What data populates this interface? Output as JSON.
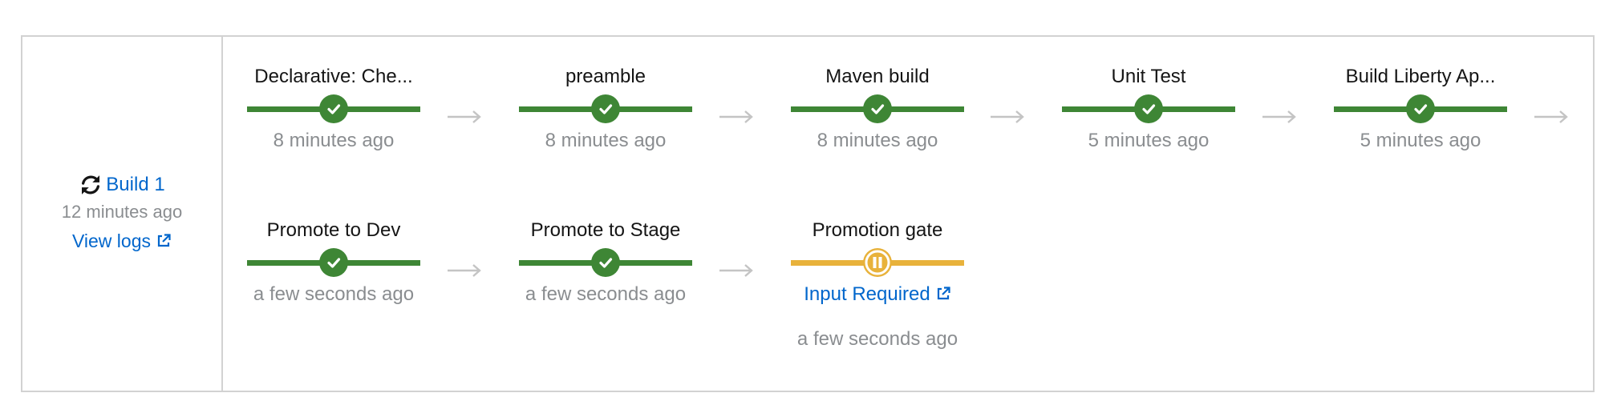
{
  "build": {
    "name": "Build 1",
    "time": "12 minutes ago",
    "view_logs": "View logs"
  },
  "tasks_row1": [
    {
      "name": "Declarative: Che...",
      "time": "8 minutes ago",
      "status": "success"
    },
    {
      "name": "preamble",
      "time": "8 minutes ago",
      "status": "success"
    },
    {
      "name": "Maven build",
      "time": "8 minutes ago",
      "status": "success"
    },
    {
      "name": "Unit Test",
      "time": "5 minutes ago",
      "status": "success"
    },
    {
      "name": "Build Liberty Ap...",
      "time": "5 minutes ago",
      "status": "success"
    }
  ],
  "tasks_row2": [
    {
      "name": "Promote to Dev",
      "time": "a few seconds ago",
      "status": "success"
    },
    {
      "name": "Promote to Stage",
      "time": "a few seconds ago",
      "status": "success"
    },
    {
      "name": "Promotion gate",
      "link": "Input Required",
      "time": "a few seconds ago",
      "status": "paused"
    }
  ],
  "colors": {
    "success": "#3e8635",
    "paused": "#e8b23b",
    "link": "#0066cc",
    "muted": "#8a8d90",
    "border": "#d2d2d2"
  },
  "icons": {
    "build": "sync-icon",
    "external": "external-link-icon",
    "success": "check-icon",
    "paused": "pause-icon",
    "connector": "arrow-right-icon"
  }
}
